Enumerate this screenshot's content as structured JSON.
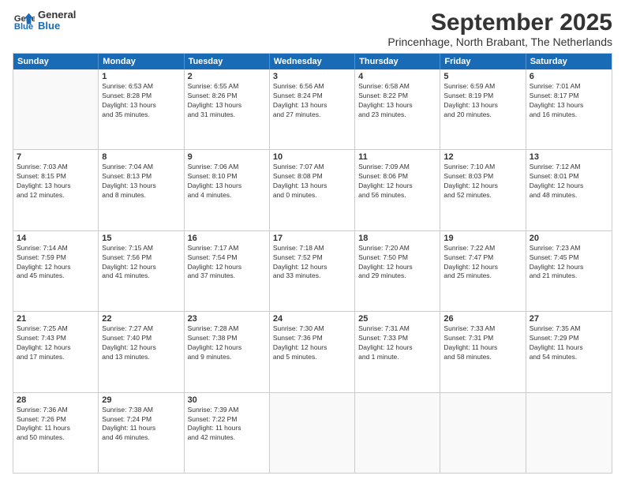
{
  "header": {
    "logo_line1": "General",
    "logo_line2": "Blue",
    "title": "September 2025",
    "subtitle": "Princenhage, North Brabant, The Netherlands"
  },
  "calendar": {
    "weekdays": [
      "Sunday",
      "Monday",
      "Tuesday",
      "Wednesday",
      "Thursday",
      "Friday",
      "Saturday"
    ],
    "rows": [
      [
        {
          "day": "",
          "info": ""
        },
        {
          "day": "1",
          "info": "Sunrise: 6:53 AM\nSunset: 8:28 PM\nDaylight: 13 hours\nand 35 minutes."
        },
        {
          "day": "2",
          "info": "Sunrise: 6:55 AM\nSunset: 8:26 PM\nDaylight: 13 hours\nand 31 minutes."
        },
        {
          "day": "3",
          "info": "Sunrise: 6:56 AM\nSunset: 8:24 PM\nDaylight: 13 hours\nand 27 minutes."
        },
        {
          "day": "4",
          "info": "Sunrise: 6:58 AM\nSunset: 8:22 PM\nDaylight: 13 hours\nand 23 minutes."
        },
        {
          "day": "5",
          "info": "Sunrise: 6:59 AM\nSunset: 8:19 PM\nDaylight: 13 hours\nand 20 minutes."
        },
        {
          "day": "6",
          "info": "Sunrise: 7:01 AM\nSunset: 8:17 PM\nDaylight: 13 hours\nand 16 minutes."
        }
      ],
      [
        {
          "day": "7",
          "info": "Sunrise: 7:03 AM\nSunset: 8:15 PM\nDaylight: 13 hours\nand 12 minutes."
        },
        {
          "day": "8",
          "info": "Sunrise: 7:04 AM\nSunset: 8:13 PM\nDaylight: 13 hours\nand 8 minutes."
        },
        {
          "day": "9",
          "info": "Sunrise: 7:06 AM\nSunset: 8:10 PM\nDaylight: 13 hours\nand 4 minutes."
        },
        {
          "day": "10",
          "info": "Sunrise: 7:07 AM\nSunset: 8:08 PM\nDaylight: 13 hours\nand 0 minutes."
        },
        {
          "day": "11",
          "info": "Sunrise: 7:09 AM\nSunset: 8:06 PM\nDaylight: 12 hours\nand 56 minutes."
        },
        {
          "day": "12",
          "info": "Sunrise: 7:10 AM\nSunset: 8:03 PM\nDaylight: 12 hours\nand 52 minutes."
        },
        {
          "day": "13",
          "info": "Sunrise: 7:12 AM\nSunset: 8:01 PM\nDaylight: 12 hours\nand 48 minutes."
        }
      ],
      [
        {
          "day": "14",
          "info": "Sunrise: 7:14 AM\nSunset: 7:59 PM\nDaylight: 12 hours\nand 45 minutes."
        },
        {
          "day": "15",
          "info": "Sunrise: 7:15 AM\nSunset: 7:56 PM\nDaylight: 12 hours\nand 41 minutes."
        },
        {
          "day": "16",
          "info": "Sunrise: 7:17 AM\nSunset: 7:54 PM\nDaylight: 12 hours\nand 37 minutes."
        },
        {
          "day": "17",
          "info": "Sunrise: 7:18 AM\nSunset: 7:52 PM\nDaylight: 12 hours\nand 33 minutes."
        },
        {
          "day": "18",
          "info": "Sunrise: 7:20 AM\nSunset: 7:50 PM\nDaylight: 12 hours\nand 29 minutes."
        },
        {
          "day": "19",
          "info": "Sunrise: 7:22 AM\nSunset: 7:47 PM\nDaylight: 12 hours\nand 25 minutes."
        },
        {
          "day": "20",
          "info": "Sunrise: 7:23 AM\nSunset: 7:45 PM\nDaylight: 12 hours\nand 21 minutes."
        }
      ],
      [
        {
          "day": "21",
          "info": "Sunrise: 7:25 AM\nSunset: 7:43 PM\nDaylight: 12 hours\nand 17 minutes."
        },
        {
          "day": "22",
          "info": "Sunrise: 7:27 AM\nSunset: 7:40 PM\nDaylight: 12 hours\nand 13 minutes."
        },
        {
          "day": "23",
          "info": "Sunrise: 7:28 AM\nSunset: 7:38 PM\nDaylight: 12 hours\nand 9 minutes."
        },
        {
          "day": "24",
          "info": "Sunrise: 7:30 AM\nSunset: 7:36 PM\nDaylight: 12 hours\nand 5 minutes."
        },
        {
          "day": "25",
          "info": "Sunrise: 7:31 AM\nSunset: 7:33 PM\nDaylight: 12 hours\nand 1 minute."
        },
        {
          "day": "26",
          "info": "Sunrise: 7:33 AM\nSunset: 7:31 PM\nDaylight: 11 hours\nand 58 minutes."
        },
        {
          "day": "27",
          "info": "Sunrise: 7:35 AM\nSunset: 7:29 PM\nDaylight: 11 hours\nand 54 minutes."
        }
      ],
      [
        {
          "day": "28",
          "info": "Sunrise: 7:36 AM\nSunset: 7:26 PM\nDaylight: 11 hours\nand 50 minutes."
        },
        {
          "day": "29",
          "info": "Sunrise: 7:38 AM\nSunset: 7:24 PM\nDaylight: 11 hours\nand 46 minutes."
        },
        {
          "day": "30",
          "info": "Sunrise: 7:39 AM\nSunset: 7:22 PM\nDaylight: 11 hours\nand 42 minutes."
        },
        {
          "day": "",
          "info": ""
        },
        {
          "day": "",
          "info": ""
        },
        {
          "day": "",
          "info": ""
        },
        {
          "day": "",
          "info": ""
        }
      ]
    ]
  }
}
